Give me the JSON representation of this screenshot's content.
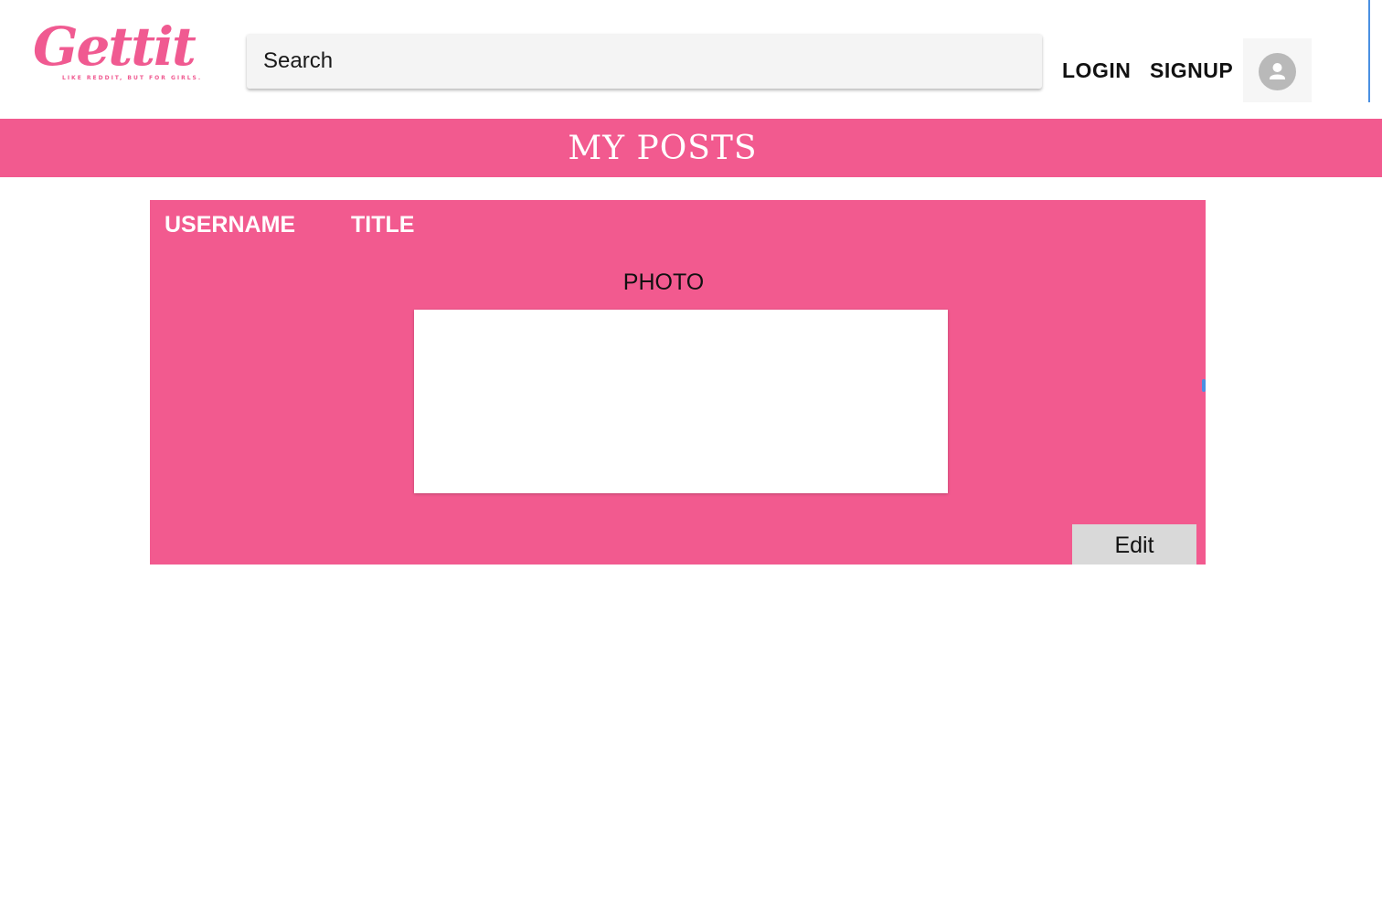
{
  "brand": {
    "logo_text": "Gettit",
    "tagline": "LIKE REDDIT, BUT FOR GIRLS."
  },
  "header": {
    "search_placeholder": "Search",
    "login_label": "LOGIN",
    "signup_label": "SIGNUP",
    "avatar_icon": "user-avatar-icon"
  },
  "banner": {
    "title": "MY POSTS"
  },
  "post": {
    "username": "USERNAME",
    "title": "TITLE",
    "photo_label": "PHOTO",
    "edit_label": "Edit"
  },
  "colors": {
    "brand_pink": "#f25a8f",
    "white": "#ffffff",
    "button_gray": "#d9d9d9"
  }
}
